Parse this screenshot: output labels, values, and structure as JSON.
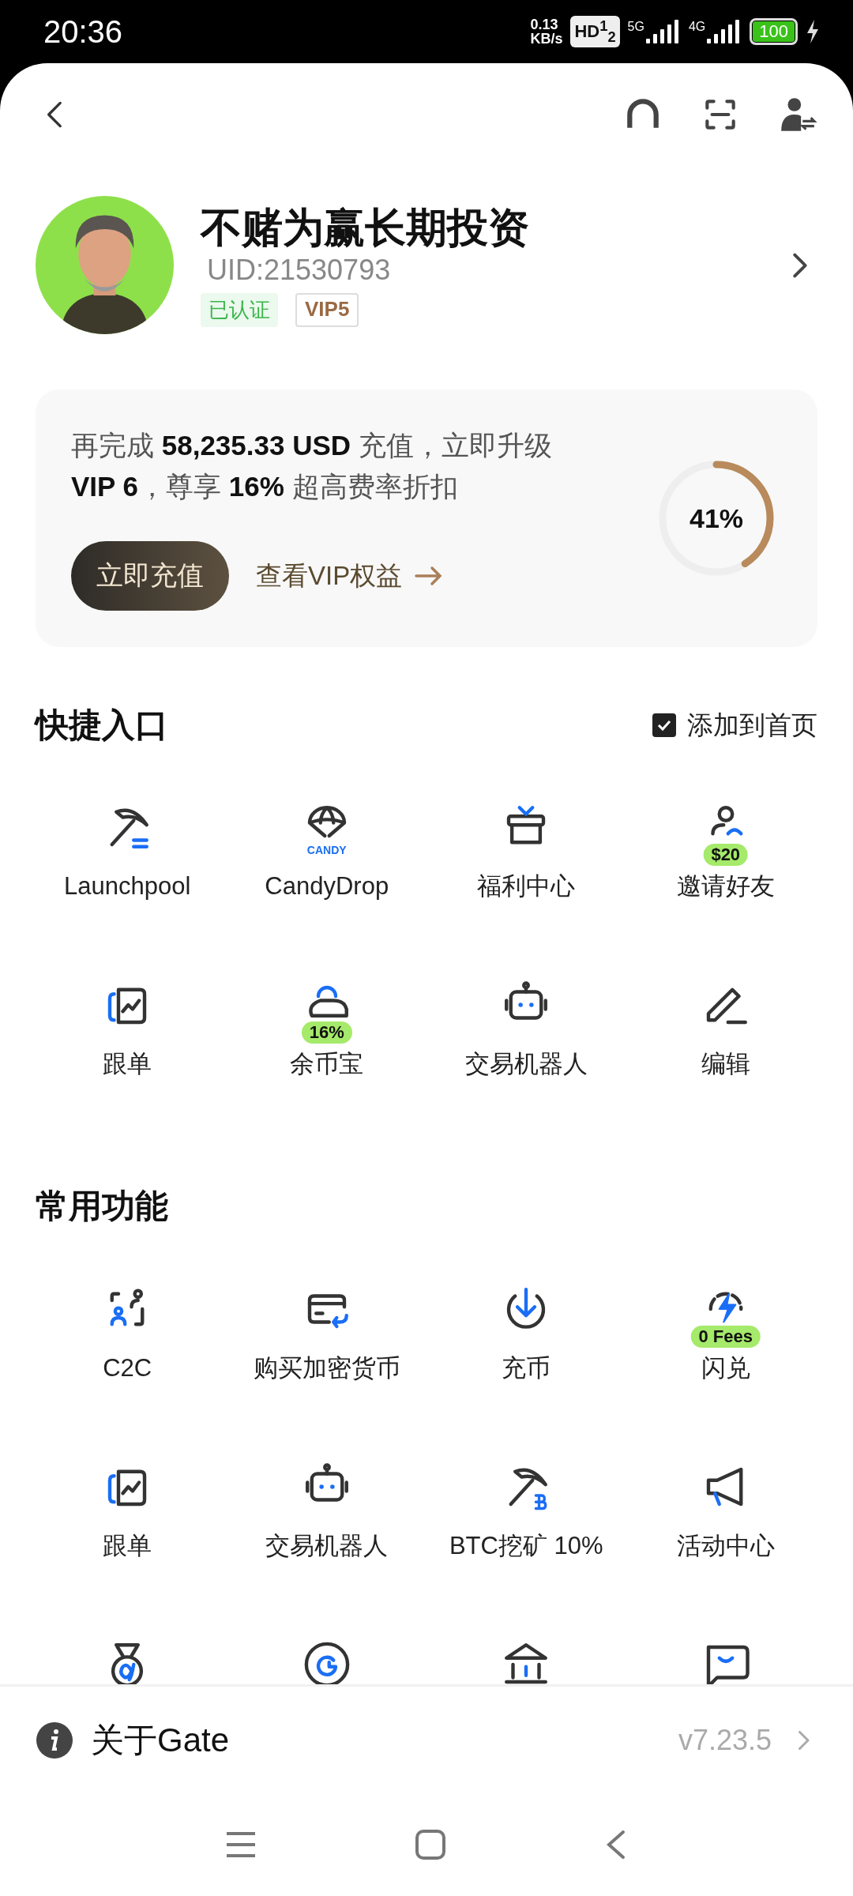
{
  "status_bar": {
    "time": "20:36",
    "net_speed": "0.13",
    "net_unit": "KB/s",
    "hd": "HD$^{1}$$_{2}$",
    "sim_1": "5G",
    "sim_2": "4G",
    "battery": "100"
  },
  "profile": {
    "name": "不赌为赢长期投资",
    "uid": "UID:21530793",
    "verified": "已认证",
    "vip": "VIP5"
  },
  "vip_card": {
    "message_lines": [
      "再完成 **58,235.33 USD** 充值，立即升级",
      "**VIP 6**，尊享 **16%** 超高费率折扣"
    ],
    "button": "立即充值",
    "link": "查看VIP权益",
    "progress": {
      "level": 0.41,
      "reading": "41%"
    }
  },
  "quick_access": {
    "title": "快捷入口",
    "add_to_home": {
      "label": "添加到首页",
      "checked": true
    },
    "items": [
      {
        "kind": "entry",
        "label": "Launchpool"
      },
      {
        "kind": "entry",
        "label": "CandyDrop",
        "icon_text": "CANDY"
      },
      {
        "kind": "entry",
        "label": "福利中心"
      },
      {
        "kind": "entry",
        "label": "邀请好友",
        "badge": "$20"
      },
      {
        "kind": "entry",
        "label": "跟单"
      },
      {
        "kind": "entry",
        "label": "余币宝",
        "badge": "16%"
      },
      {
        "kind": "entry",
        "label": "交易机器人"
      },
      {
        "kind": "entry",
        "label": "编辑"
      }
    ]
  },
  "common_functions": {
    "title": "常用功能",
    "items": [
      {
        "kind": "entry",
        "label": "C2C"
      },
      {
        "kind": "entry",
        "label": "购买加密货币"
      },
      {
        "kind": "entry",
        "label": "充币"
      },
      {
        "kind": "entry",
        "label": "闪兑",
        "badge": "0 Fees"
      },
      {
        "kind": "entry",
        "label": "跟单"
      },
      {
        "kind": "entry",
        "label": "交易机器人"
      },
      {
        "kind": "entry",
        "label": "BTC挖矿 10%"
      },
      {
        "kind": "entry",
        "label": "活动中心"
      },
      {
        "kind": "partial"
      },
      {
        "kind": "partial"
      },
      {
        "kind": "partial"
      },
      {
        "kind": "partial"
      }
    ]
  },
  "about": {
    "label": "关于Gate",
    "version": "v7.23.5"
  }
}
